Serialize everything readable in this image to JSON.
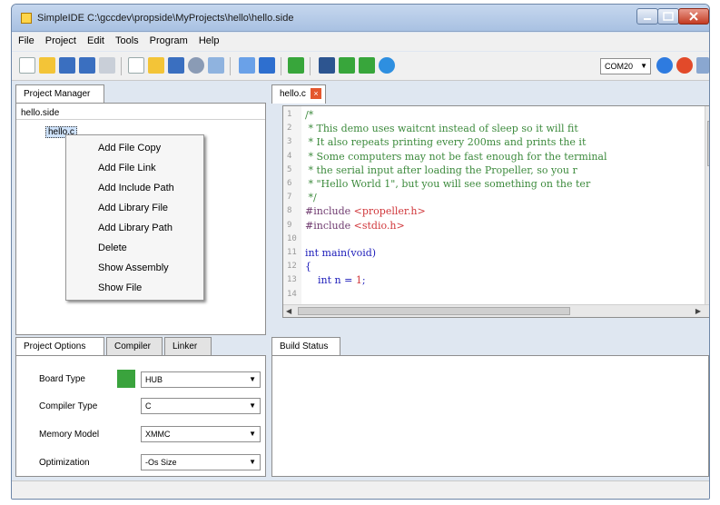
{
  "window": {
    "title": "SimpleIDE C:\\gccdev\\propside\\MyProjects\\hello\\hello.side"
  },
  "menu": [
    "File",
    "Project",
    "Edit",
    "Tools",
    "Program",
    "Help"
  ],
  "toolbar": {
    "port": "COM20"
  },
  "project_manager": {
    "tab": "Project Manager",
    "root": "hello.side",
    "file": "hello.c"
  },
  "context_menu": [
    "Add File Copy",
    "Add File Link",
    "Add Include Path",
    "Add Library File",
    "Add Library Path",
    "Delete",
    "Show Assembly",
    "Show File"
  ],
  "editor": {
    "tab": "hello.c",
    "line_numbers": [
      "1",
      "2",
      "3",
      "4",
      "5",
      "6",
      "7",
      "8",
      "9",
      "10",
      "11",
      "12",
      "13",
      "14"
    ],
    "lines": [
      {
        "t": "/*",
        "c": "cmt"
      },
      {
        "t": " * This demo uses waitcnt instead of sleep so it will fit",
        "c": "cmt"
      },
      {
        "t": " * It also repeats printing every 200ms and prints the it",
        "c": "cmt"
      },
      {
        "t": " * Some computers may not be fast enough for the terminal",
        "c": "cmt"
      },
      {
        "t": " * the serial input after loading the Propeller, so you r",
        "c": "cmt"
      },
      {
        "t": " * \"Hello World 1\", but you will see something on the ter",
        "c": "cmt"
      },
      {
        "t": " */",
        "c": "cmt"
      },
      {
        "t": "#include <propeller.h>",
        "c": "inc"
      },
      {
        "t": "#include <stdio.h>",
        "c": "inc"
      },
      {
        "t": "",
        "c": ""
      },
      {
        "t": "int main(void)",
        "c": "kw"
      },
      {
        "t": "{",
        "c": "kw"
      },
      {
        "t": "    int n = 1;",
        "c": "decl"
      },
      {
        "t": "",
        "c": ""
      }
    ]
  },
  "options": {
    "tabs": [
      "Project Options",
      "Compiler",
      "Linker"
    ],
    "rows": [
      {
        "label": "Board Type",
        "value": "HUB"
      },
      {
        "label": "Compiler Type",
        "value": "C"
      },
      {
        "label": "Memory Model",
        "value": "XMMC"
      },
      {
        "label": "Optimization",
        "value": "-Os Size"
      }
    ]
  },
  "build": {
    "tab": "Build Status"
  },
  "colors": {
    "accent": "#2e6fcf",
    "close": "#c43b22",
    "comment": "#3c8a3c",
    "keyword": "#1c1cba",
    "string": "#d0363a"
  }
}
